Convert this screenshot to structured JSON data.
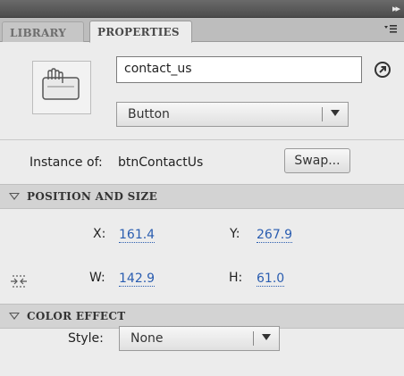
{
  "panel": {
    "tabs": [
      {
        "label": "LIBRARY",
        "active": false
      },
      {
        "label": "PROPERTIES",
        "active": true
      }
    ],
    "collapse_icon": "double-chevron-right-icon",
    "menu_icon": "panel-menu-icon"
  },
  "symbol": {
    "thumbnail_icon": "button-symbol-icon",
    "instance_name": "contact_us",
    "link_icon": "arrow-circle-icon",
    "type": "Button"
  },
  "instance": {
    "label": "Instance of:",
    "value": "btnContactUs",
    "swap_label": "Swap..."
  },
  "position_size": {
    "title": "POSITION AND SIZE",
    "x_label": "X:",
    "x_value": "161.4",
    "y_label": "Y:",
    "y_value": "267.9",
    "w_label": "W:",
    "w_value": "142.9",
    "h_label": "H:",
    "h_value": "61.0",
    "lock_icon": "constrain-proportions-icon"
  },
  "color_effect": {
    "title": "COLOR EFFECT",
    "style_label": "Style:",
    "style_value": "None"
  },
  "colors": {
    "link_value": "#2a5db0",
    "panel_bg": "#ececec",
    "section_bg": "#d3d3d3"
  }
}
